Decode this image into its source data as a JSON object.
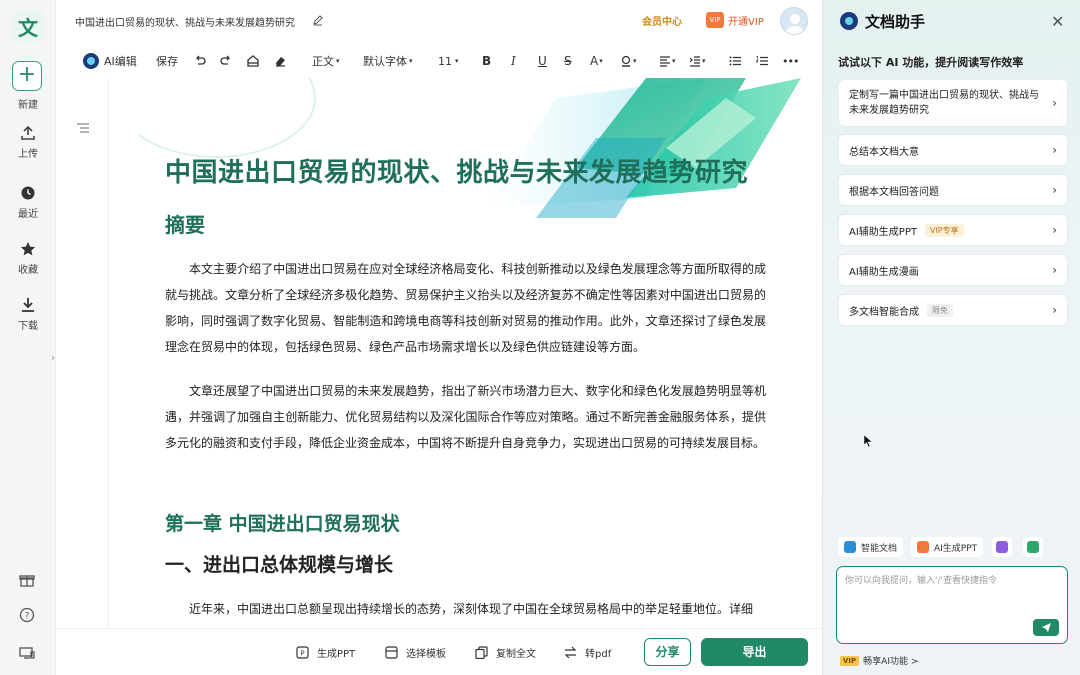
{
  "app": {
    "logo": "文",
    "colors": {
      "primary": "#1f8a65",
      "heading": "#1f6f5a",
      "member": "#d28b16",
      "vip": "#e0541f"
    }
  },
  "sidebar": {
    "new_label": "新建",
    "items": [
      {
        "label": "上传",
        "icon": "upload-icon"
      },
      {
        "label": "最近",
        "icon": "clock-icon"
      },
      {
        "label": "收藏",
        "icon": "star-icon"
      },
      {
        "label": "下载",
        "icon": "download-icon"
      }
    ],
    "bottom_icons": [
      "gift-icon",
      "help-icon",
      "device-icon"
    ]
  },
  "header": {
    "doc_title": "中国进出口贸易的现状、挑战与未来发展趋势研究",
    "member_center": "会员中心",
    "vip_badge": "VIP",
    "open_vip": "开通VIP"
  },
  "toolbar": {
    "ai_edit": "AI编辑",
    "save": "保存",
    "style": "正文",
    "font": "默认字体",
    "size": "11",
    "more": "•••"
  },
  "doc": {
    "title": "中国进出口贸易的现状、挑战与未来发展趋势研究",
    "abstract_heading": "摘要",
    "paragraphs": [
      "本文主要介绍了中国进出口贸易在应对全球经济格局变化、科技创新推动以及绿色发展理念等方面所取得的成就与挑战。文章分析了全球经济多极化趋势、贸易保护主义抬头以及经济复苏不确定性等因素对中国进出口贸易的影响，同时强调了数字化贸易、智能制造和跨境电商等科技创新对贸易的推动作用。此外，文章还探讨了绿色发展理念在贸易中的体现，包括绿色贸易、绿色产品市场需求增长以及绿色供应链建设等方面。",
      "文章还展望了中国进出口贸易的未来发展趋势，指出了新兴市场潜力巨大、数字化和绿色化发展趋势明显等机遇，并强调了加强自主创新能力、优化贸易结构以及深化国际合作等应对策略。通过不断完善金融服务体系，提供多元化的融资和支付手段，降低企业资金成本，中国将不断提升自身竞争力，实现进出口贸易的可持续发展目标。",
      "近年来，中国进出口总额呈现出持续增长的态势，深刻体现了中国在全球贸易格局中的举足轻重地位。详细"
    ],
    "chapter_heading": "第一章 中国进出口贸易现状",
    "section_heading": "一、进出口总体规模与增长"
  },
  "bottombar": {
    "gen_ppt": "生成PPT",
    "template": "选择模板",
    "copy_all": "复制全文",
    "to_pdf": "转pdf",
    "share": "分享",
    "export": "导出"
  },
  "panel": {
    "title": "文档助手",
    "close": "✕",
    "subtitle": "试试以下 AI 功能，提升阅读写作效率",
    "cards": [
      {
        "label": "定制写一篇中国进出口贸易的现状、挑战与未来发展趋势研究",
        "tag": ""
      },
      {
        "label": "总结本文档大意",
        "tag": ""
      },
      {
        "label": "根据本文档回答问题",
        "tag": ""
      },
      {
        "label": "AI辅助生成PPT",
        "tag": "VIP专享"
      },
      {
        "label": "AI辅助生成漫画",
        "tag": ""
      },
      {
        "label": "多文档智能合成",
        "tag": "限免"
      }
    ],
    "quick_actions": [
      {
        "label": "智能文档",
        "color": "#2b8fd6"
      },
      {
        "label": "AI生成PPT",
        "color": "#f07a3a"
      }
    ],
    "input_placeholder": "你可以向我提问，输入'/'查看快捷指令",
    "vip_badge": "VIP",
    "vip_ai": "畅享AI功能 >"
  }
}
